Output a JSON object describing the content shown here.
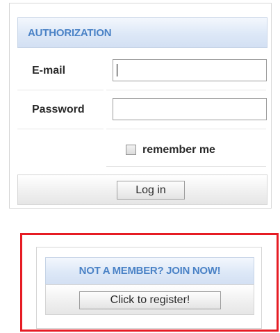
{
  "login": {
    "header": "AUTHORIZATION",
    "email_label": "E-mail",
    "email_value": "",
    "password_label": "Password",
    "password_value": "",
    "remember_label": "remember me",
    "remember_checked": false,
    "submit_label": "Log in"
  },
  "register": {
    "header": "NOT A MEMBER? JOIN NOW!",
    "button_label": "Click to register!"
  },
  "colors": {
    "header_text": "#4a82c6",
    "highlight_border": "#e61c24"
  }
}
